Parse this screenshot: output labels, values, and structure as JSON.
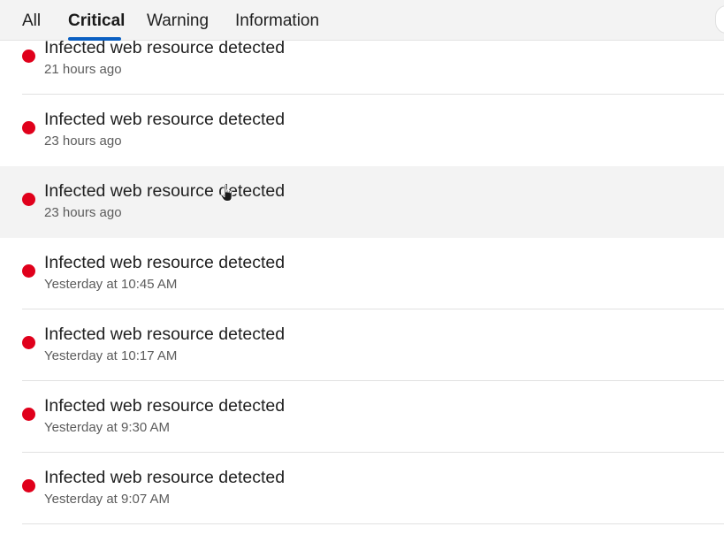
{
  "tabs": [
    {
      "label": "All",
      "active": false
    },
    {
      "label": "Critical",
      "active": true
    },
    {
      "label": "Warning",
      "active": false
    },
    {
      "label": "Information",
      "active": false
    }
  ],
  "notifications": [
    {
      "title": "Infected web resource detected",
      "time": "21 hours ago",
      "severity": "critical"
    },
    {
      "title": "Infected web resource detected",
      "time": "23 hours ago",
      "severity": "critical"
    },
    {
      "title": "Infected web resource detected",
      "time": "23 hours ago",
      "severity": "critical"
    },
    {
      "title": "Infected web resource detected",
      "time": "Yesterday at 10:45 AM",
      "severity": "critical"
    },
    {
      "title": "Infected web resource detected",
      "time": "Yesterday at 10:17 AM",
      "severity": "critical"
    },
    {
      "title": "Infected web resource detected",
      "time": "Yesterday at 9:30 AM",
      "severity": "critical"
    },
    {
      "title": "Infected web resource detected",
      "time": "Yesterday at 9:07 AM",
      "severity": "critical"
    }
  ],
  "colors": {
    "critical_dot": "#e0001b",
    "accent": "#0a5fc2",
    "hover_background": "#f3f3f3"
  },
  "cursor": {
    "icon": "hand-pointer-icon"
  }
}
